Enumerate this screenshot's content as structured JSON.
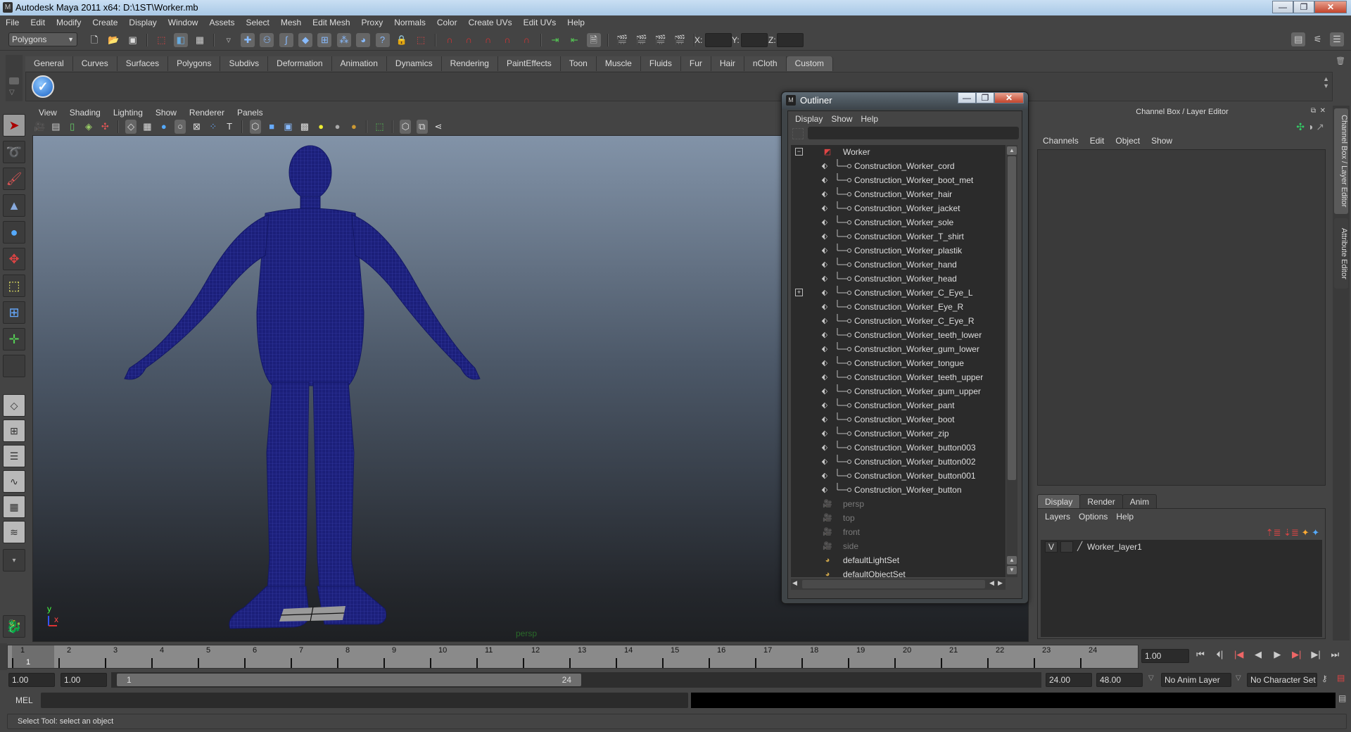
{
  "window": {
    "title": "Autodesk Maya 2011 x64: D:\\1ST\\Worker.mb",
    "minimize": "—",
    "restore": "❐",
    "close": "✕"
  },
  "menubar": [
    "File",
    "Edit",
    "Modify",
    "Create",
    "Display",
    "Window",
    "Assets",
    "Select",
    "Mesh",
    "Edit Mesh",
    "Proxy",
    "Normals",
    "Color",
    "Create UVs",
    "Edit UVs",
    "Help"
  ],
  "statusline": {
    "menuset": "Polygons",
    "x_label": "X:",
    "y_label": "Y:",
    "z_label": "Z:",
    "x_value": "",
    "y_value": "",
    "z_value": ""
  },
  "shelf": {
    "tabs": [
      "General",
      "Curves",
      "Surfaces",
      "Polygons",
      "Subdivs",
      "Deformation",
      "Animation",
      "Dynamics",
      "Rendering",
      "PaintEffects",
      "Toon",
      "Muscle",
      "Fluids",
      "Fur",
      "Hair",
      "nCloth",
      "Custom"
    ],
    "active_tab": "Custom"
  },
  "viewport": {
    "menu": [
      "View",
      "Shading",
      "Lighting",
      "Show",
      "Renderer",
      "Panels"
    ],
    "camera_label": "persp",
    "axis_y": "y",
    "axis_x": "x",
    "mesh_color": "#1b1f7a"
  },
  "outliner": {
    "title": "Outliner",
    "menu": [
      "Display",
      "Show",
      "Help"
    ],
    "filter_value": "",
    "root": "Worker",
    "children": [
      "Construction_Worker_cord",
      "Construction_Worker_boot_met",
      "Construction_Worker_hair",
      "Construction_Worker_jacket",
      "Construction_Worker_sole",
      "Construction_Worker_T_shirt",
      "Construction_Worker_plastik",
      "Construction_Worker_hand",
      "Construction_Worker_head",
      "Construction_Worker_C_Eye_L",
      "Construction_Worker_Eye_R",
      "Construction_Worker_C_Eye_R",
      "Construction_Worker_teeth_lower",
      "Construction_Worker_gum_lower",
      "Construction_Worker_tongue",
      "Construction_Worker_teeth_upper",
      "Construction_Worker_gum_upper",
      "Construction_Worker_pant",
      "Construction_Worker_boot",
      "Construction_Worker_zip",
      "Construction_Worker_button003",
      "Construction_Worker_button002",
      "Construction_Worker_button001",
      "Construction_Worker_button"
    ],
    "cameras": [
      "persp",
      "top",
      "front",
      "side"
    ],
    "sets": [
      "defaultLightSet",
      "defaultObjectSet"
    ]
  },
  "channel_box": {
    "title": "Channel Box / Layer Editor",
    "menu": [
      "Channels",
      "Edit",
      "Object",
      "Show"
    ],
    "layer_tabs": [
      "Display",
      "Render",
      "Anim"
    ],
    "active_layer_tab": "Display",
    "layer_menu": [
      "Layers",
      "Options",
      "Help"
    ],
    "layers": [
      {
        "visible": "V",
        "name": "Worker_layer1"
      }
    ]
  },
  "side_tabs": [
    "Channel Box / Layer Editor",
    "Attribute Editor"
  ],
  "timeline": {
    "ticks": [
      "1",
      "2",
      "3",
      "4",
      "5",
      "6",
      "7",
      "8",
      "9",
      "10",
      "11",
      "12",
      "13",
      "14",
      "15",
      "16",
      "17",
      "18",
      "19",
      "20",
      "21",
      "22",
      "23",
      "24"
    ],
    "current_frame_marker": "1",
    "current_time": "1.00"
  },
  "range": {
    "start": "1.00",
    "playback_start": "1.00",
    "slider_start": "1",
    "slider_end": "24",
    "playback_end": "24.00",
    "end": "48.00",
    "anim_layer": "No Anim Layer",
    "character_set": "No Character Set"
  },
  "command_line": {
    "label": "MEL",
    "value": ""
  },
  "help_line": "Select Tool: select an object"
}
